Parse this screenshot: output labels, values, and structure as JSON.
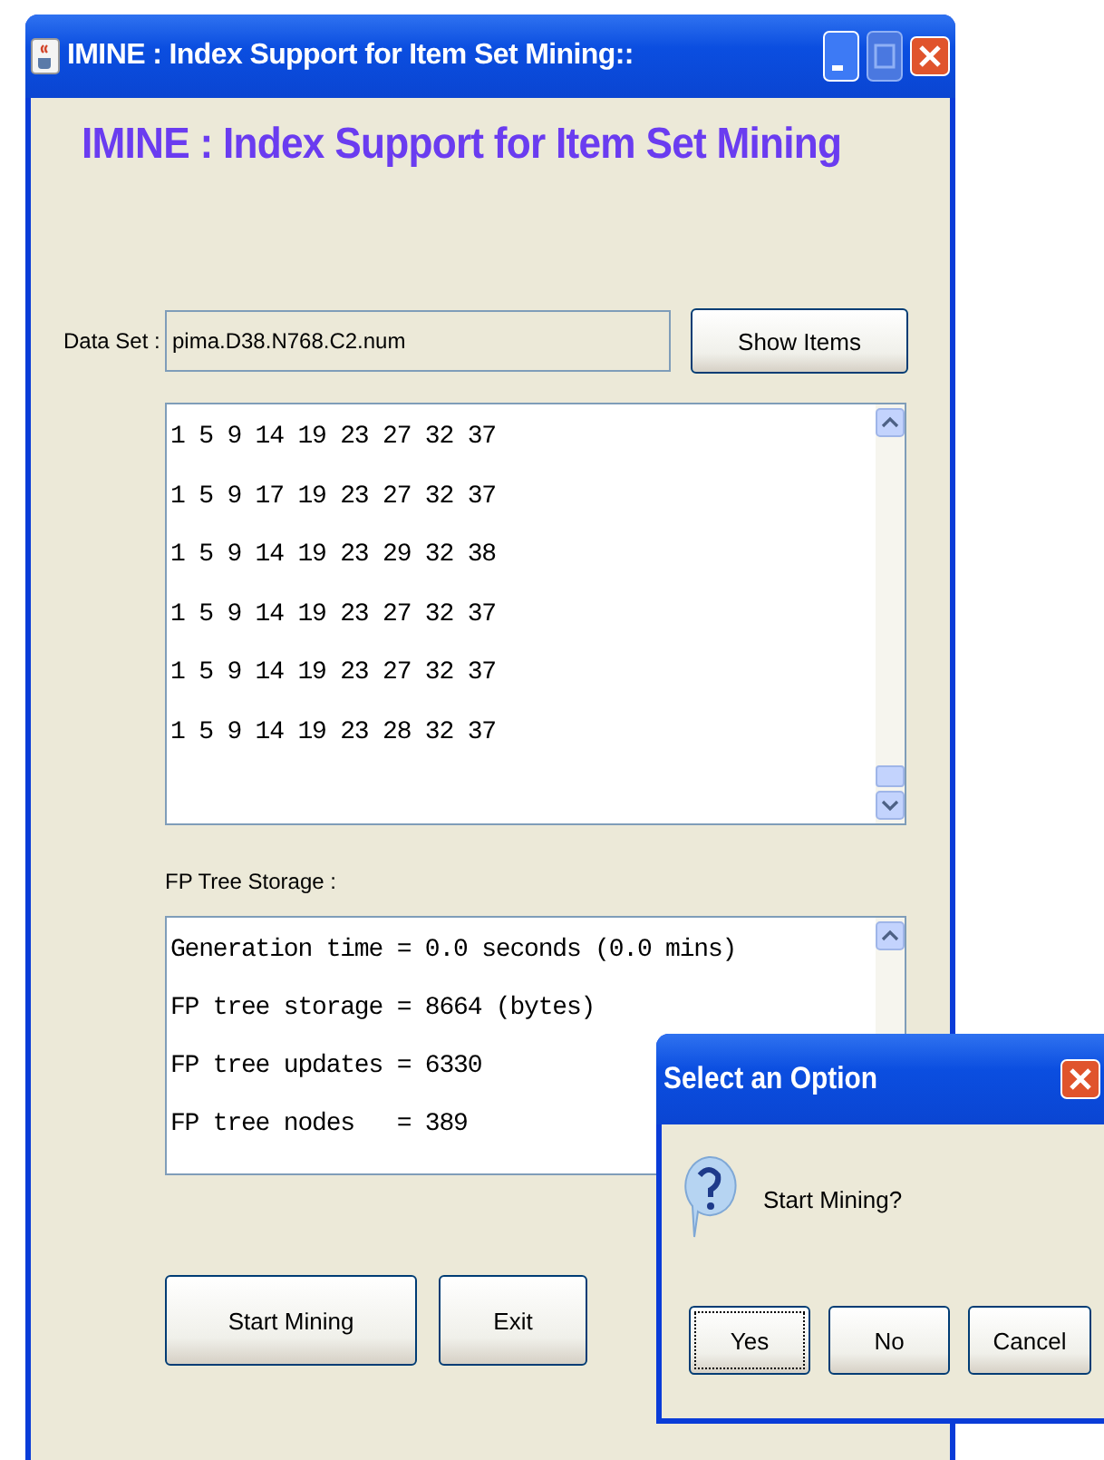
{
  "window": {
    "title": "IMINE : Index Support for Item Set Mining::"
  },
  "heading": "IMINE : Index Support for Item Set Mining",
  "data_set": {
    "label": "Data Set :",
    "value": "pima.D38.N768.C2.num",
    "button": "Show Items"
  },
  "items_list": [
    "1 5 9 14 19 23 27 32 37",
    "1 5 9 17 19 23 27 32 37",
    "1 5 9 14 19 23 29 32 38",
    "1 5 9 14 19 23 27 32 37",
    "1 5 9 14 19 23 27 32 37",
    "1 5 9 14 19 23 28 32 37"
  ],
  "fp_tree": {
    "label": "FP Tree Storage :",
    "lines": [
      "Generation time = 0.0 seconds (0.0 mins)",
      "FP tree storage = 8664 (bytes)",
      "FP tree updates = 6330",
      "FP tree nodes   = 389"
    ]
  },
  "buttons": [
    "Start Mining",
    "Exit"
  ],
  "dialog": {
    "title": "Select an Option",
    "message": "Start Mining?",
    "buttons": [
      {
        "label": "Yes",
        "selected": true
      },
      {
        "label": "No",
        "selected": false
      },
      {
        "label": "Cancel",
        "selected": false
      }
    ]
  }
}
